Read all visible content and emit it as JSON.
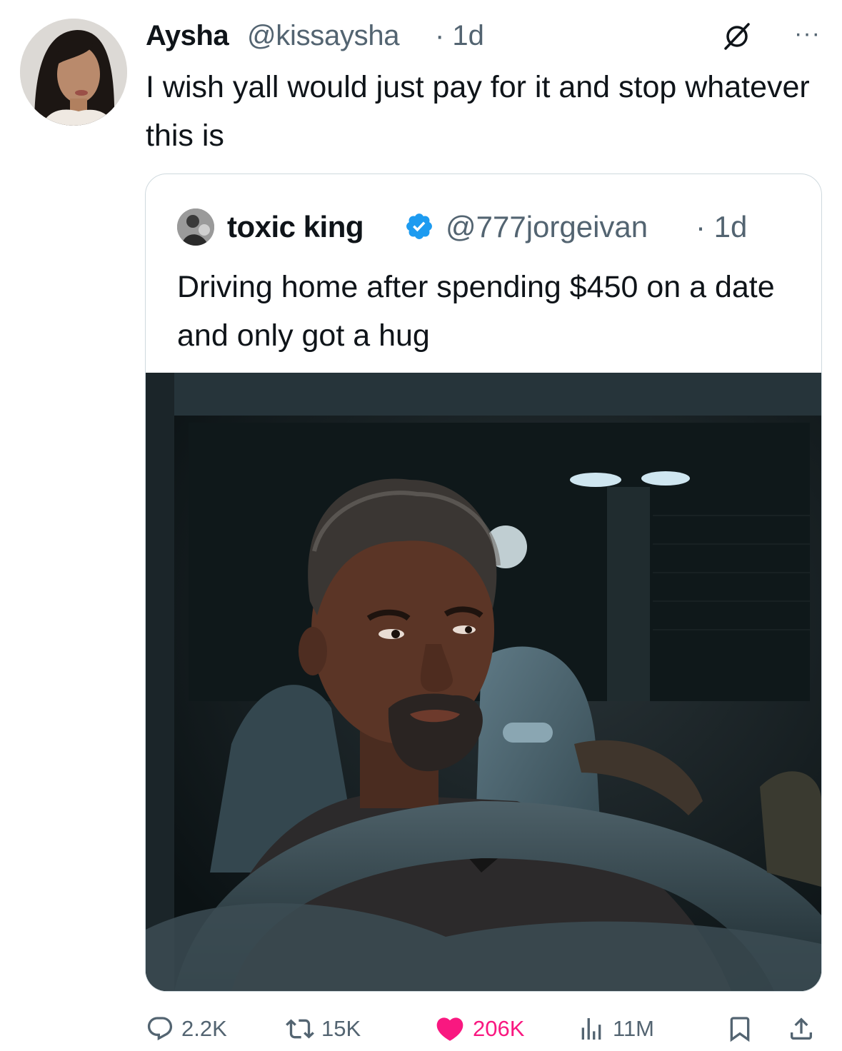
{
  "tweet": {
    "display_name": "Aysha",
    "handle": "@kissaysha",
    "time": "· 1d",
    "more": "···",
    "text": "I wish yall would just pay for it and stop whatever this is"
  },
  "quoted": {
    "display_name": "toxic king",
    "handle": "@777jorgeivan",
    "time": "· 1d",
    "text": "Driving home after spending $450 on a date and only got a hug"
  },
  "actions": {
    "replies": "2.2K",
    "reposts": "15K",
    "likes": "206K",
    "views": "11M"
  },
  "colors": {
    "like_active": "#f91880",
    "verified": "#1d9bf0",
    "muted": "#536471"
  },
  "icons": [
    "grok-icon",
    "more-icon",
    "verified-icon",
    "reply-icon",
    "repost-icon",
    "like-icon",
    "views-icon",
    "bookmark-icon",
    "share-icon"
  ]
}
